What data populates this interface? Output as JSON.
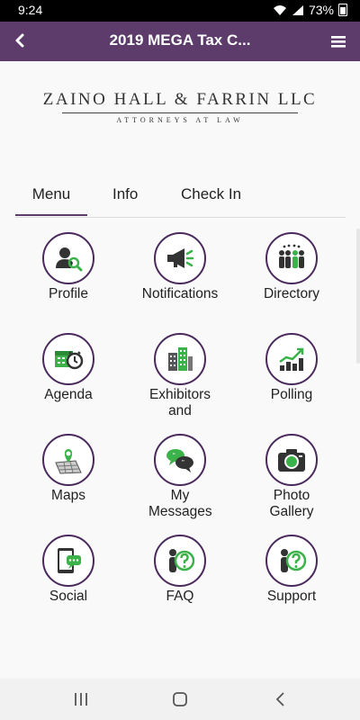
{
  "status": {
    "time": "9:24",
    "battery": "73%"
  },
  "appbar": {
    "title": "2019 MEGA Tax C..."
  },
  "logo": {
    "name": "ZAINO HALL & FARRIN LLC",
    "subtitle": "ATTORNEYS AT LAW"
  },
  "tabs": [
    {
      "label": "Menu",
      "active": true
    },
    {
      "label": "Info",
      "active": false
    },
    {
      "label": "Check In",
      "active": false
    }
  ],
  "menu_items": [
    {
      "label": "Profile",
      "icon": "profile-icon"
    },
    {
      "label": "Notifications",
      "icon": "megaphone-icon"
    },
    {
      "label": "Directory",
      "icon": "people-icon"
    },
    {
      "label": "Agenda",
      "icon": "calendar-clock-icon"
    },
    {
      "label": "Exhibitors and",
      "icon": "buildings-icon"
    },
    {
      "label": "Polling",
      "icon": "bar-chart-icon"
    },
    {
      "label": "Maps",
      "icon": "map-pin-icon"
    },
    {
      "label": "My Messages",
      "icon": "chat-bubbles-icon"
    },
    {
      "label": "Photo Gallery",
      "icon": "camera-icon"
    },
    {
      "label": "Social",
      "icon": "phone-chat-icon"
    },
    {
      "label": "FAQ",
      "icon": "person-question-icon"
    },
    {
      "label": "Support",
      "icon": "person-question-icon"
    }
  ],
  "colors": {
    "appbar": "#5d3c6c",
    "accent_green": "#3cb34a",
    "icon_dark": "#333333",
    "circle_border": "#4a2a5c"
  }
}
